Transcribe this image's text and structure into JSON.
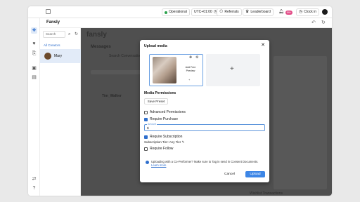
{
  "topbar": {
    "status": "Operational",
    "timezone": "UTC+01:00",
    "referrals": "Referrals",
    "leaderboard": "Leaderboard",
    "notif_badge": "99+",
    "clock_in": "Clock in"
  },
  "subbar": {
    "title": "Fansly"
  },
  "creators": {
    "search_placeholder": "Search",
    "filter_label": "All Creators",
    "items": [
      {
        "name": "Mary"
      }
    ]
  },
  "main": {
    "logo": "fansly",
    "heading": "Messages",
    "search_placeholder": "Search Conversations",
    "conversation_name": "Tim_Walker",
    "footer_text": "Wishlist Transactions"
  },
  "modal": {
    "title": "Upload media",
    "thumb_label": "Add Free Preview",
    "permissions_heading": "Media Permissions",
    "preset_button": "Save Preset",
    "advanced_permissions": "Advanced Permissions",
    "require_purchase": "Require Purchase",
    "amount_label": "Amount",
    "amount_value": "$",
    "require_subscription": "Require Subscription",
    "subscription_tier_label": "Subscription Tier:",
    "subscription_tier_value": "Any Tier",
    "require_follow": "Require Follow",
    "info_text": "Uploading with a Co-Performer? Make sure to Tag in send in Consent Documents.",
    "info_link": "Learn more",
    "cancel": "Cancel",
    "upload": "Upload"
  },
  "colors": {
    "accent": "#3d86e6",
    "status_green": "#2ba24c",
    "badge": "#e24b86"
  }
}
